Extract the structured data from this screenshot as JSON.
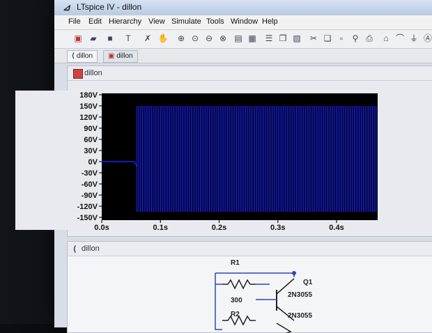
{
  "window": {
    "title": "LTspice IV - dillon"
  },
  "menu": [
    "File",
    "Edit",
    "Hierarchy",
    "View",
    "Simulate",
    "Tools",
    "Window",
    "Help"
  ],
  "tabs": [
    {
      "label": "dillon",
      "icon": "schematic-icon"
    },
    {
      "label": "dillon",
      "icon": "waveform-icon"
    }
  ],
  "plot_pane": {
    "title": "dillon"
  },
  "chart_data": {
    "type": "line",
    "xlabel": "",
    "ylabel": "",
    "x_ticks": [
      "0.0s",
      "0.1s",
      "0.2s",
      "0.3s",
      "0.4s"
    ],
    "y_ticks": [
      "180V",
      "150V",
      "120V",
      "90V",
      "60V",
      "30V",
      "0V",
      "-30V",
      "-60V",
      "-90V",
      "-120V",
      "-150V"
    ],
    "xlim": [
      0,
      0.47
    ],
    "ylim": [
      -150,
      180
    ],
    "grid": false,
    "series": [
      {
        "color": "#1a23ff",
        "x": [
          0,
          0.056,
          0.06,
          0.47
        ],
        "y_upper": [
          0,
          0,
          150,
          150
        ],
        "y_lower": [
          0,
          0,
          -135,
          -135
        ],
        "flat_level": 0
      }
    ]
  },
  "schematic_pane": {
    "title": "dillon"
  },
  "schematic": {
    "r1_name": "R1",
    "r1_value": "300",
    "r2_name": "R2",
    "q1_name": "Q1",
    "q1_model": "2N3055",
    "q1_model2": "2N3055"
  }
}
